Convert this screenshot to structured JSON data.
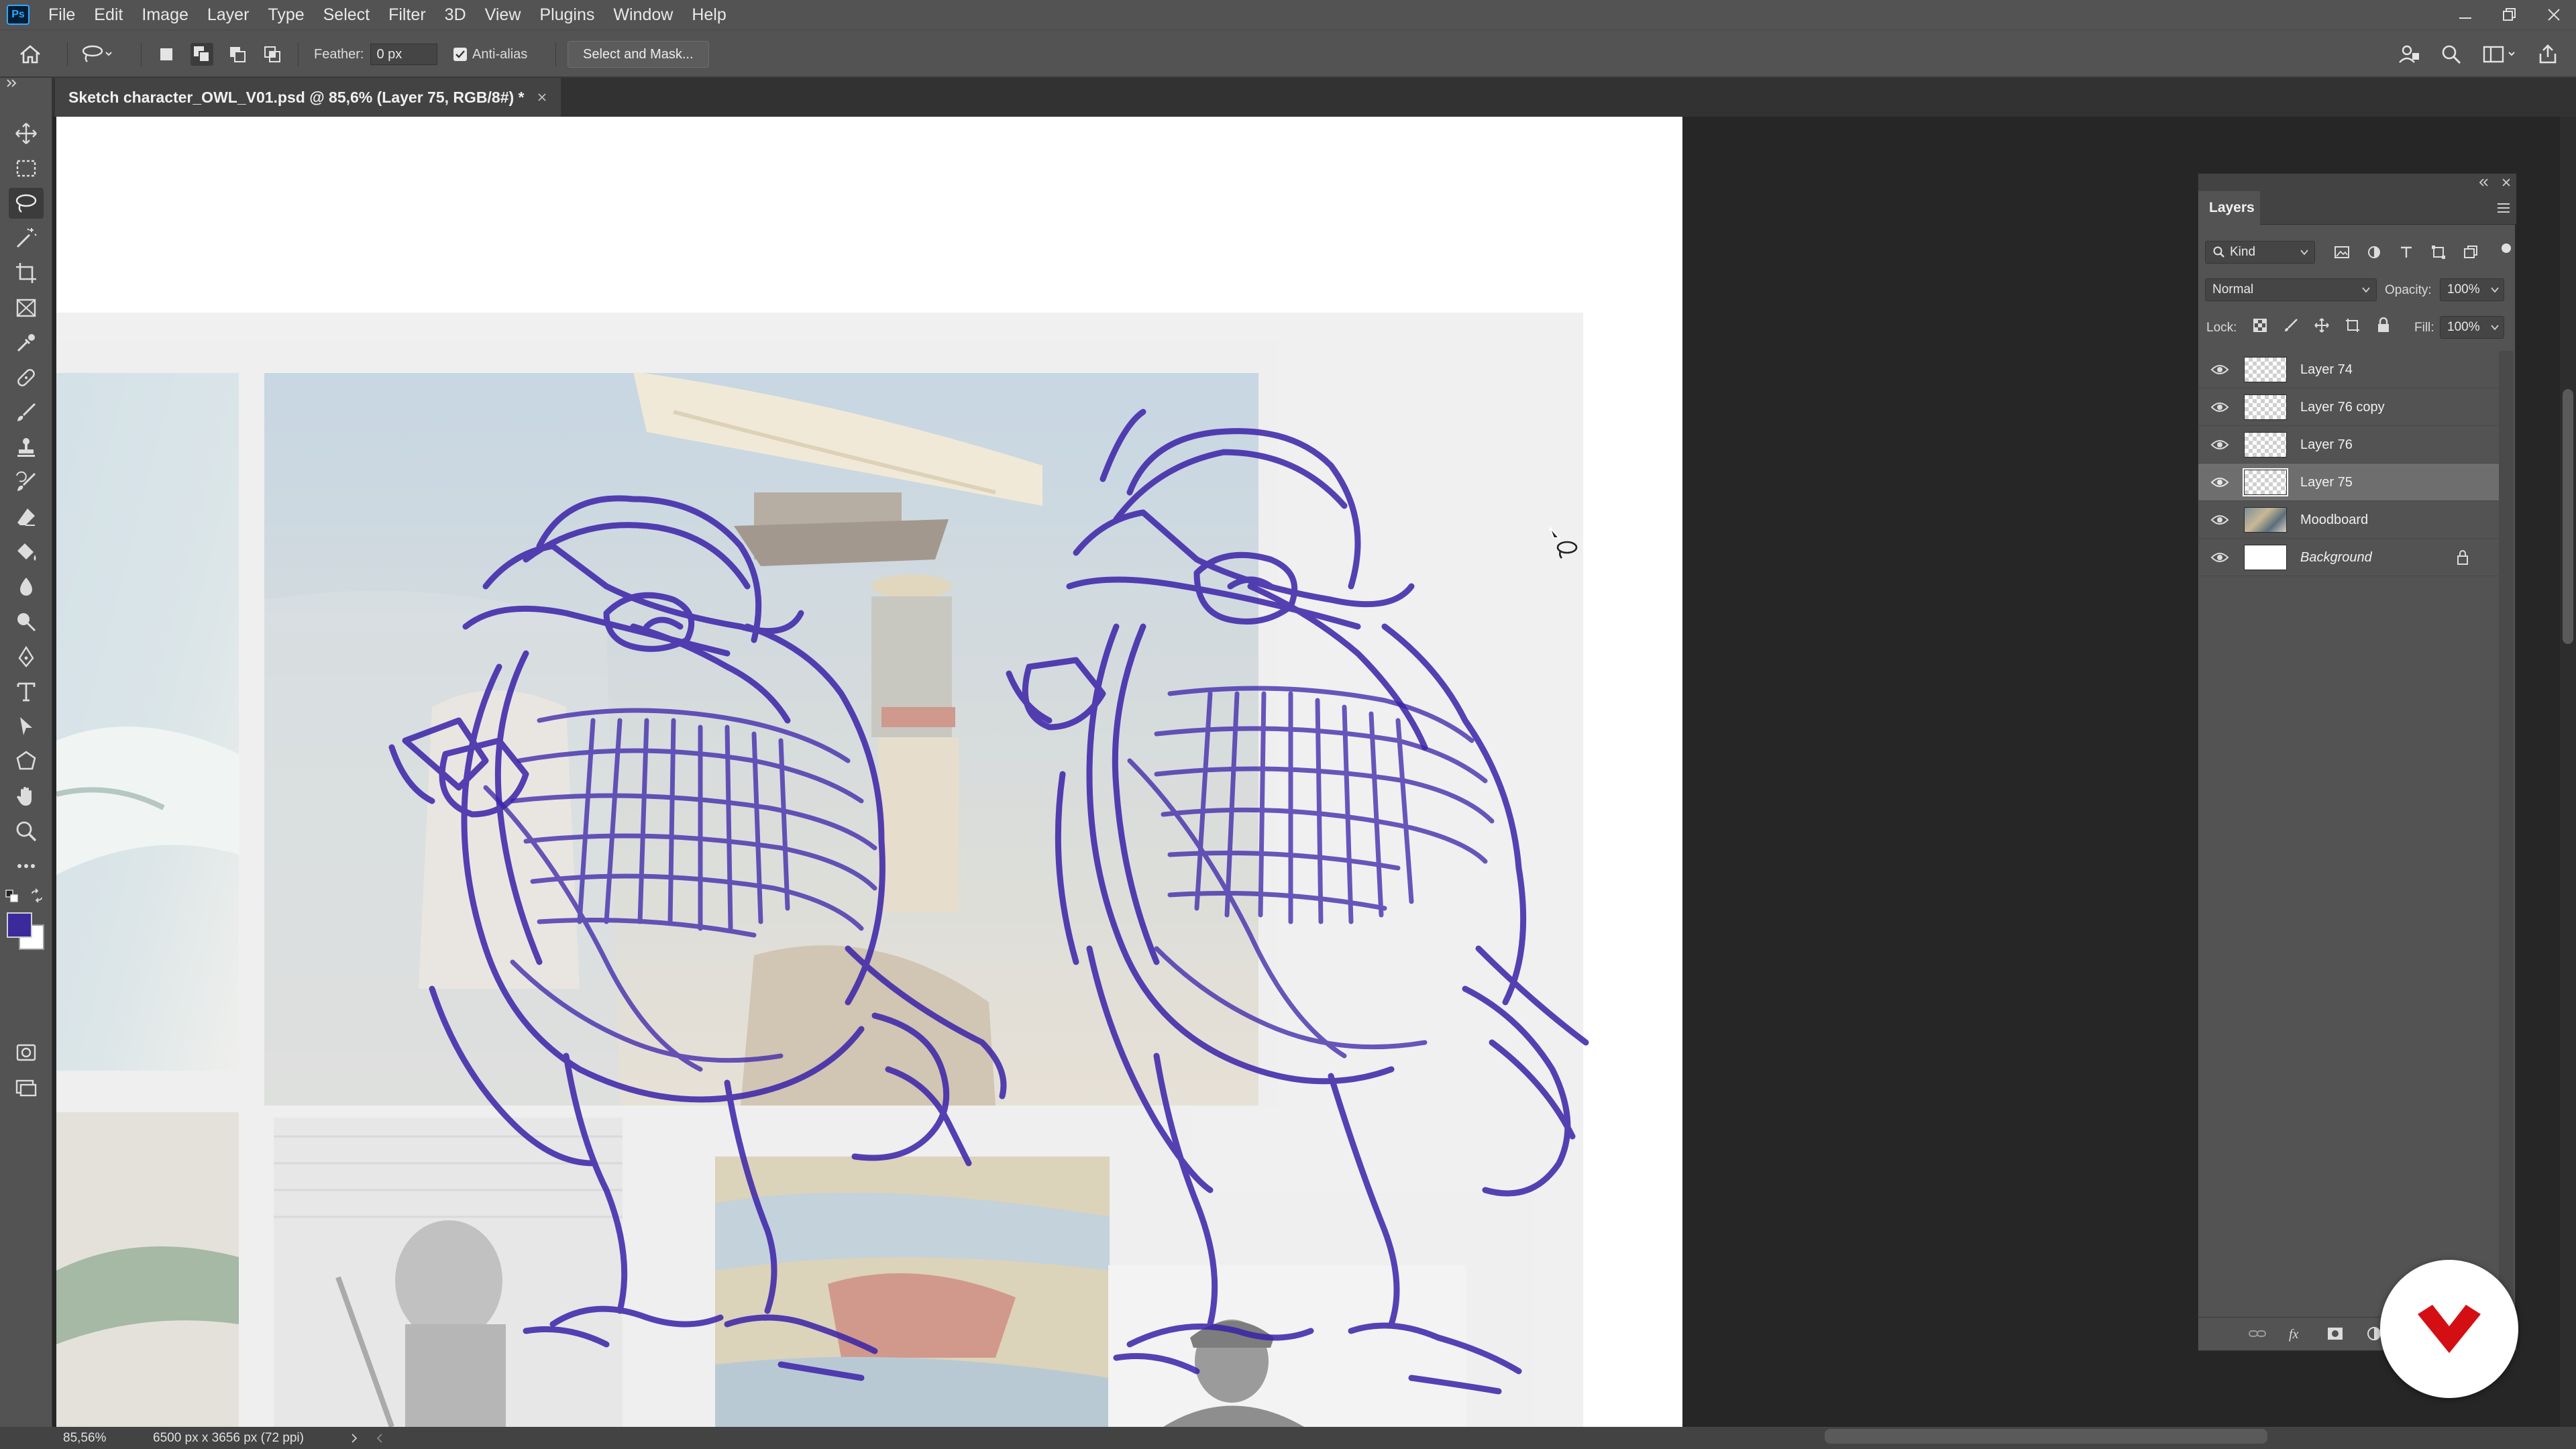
{
  "app": {
    "logo": "Ps"
  },
  "menu": [
    "File",
    "Edit",
    "Image",
    "Layer",
    "Type",
    "Select",
    "Filter",
    "3D",
    "View",
    "Plugins",
    "Window",
    "Help"
  ],
  "options": {
    "feather_label": "Feather:",
    "feather_value": "0 px",
    "antialias_label": "Anti-alias",
    "antialias_checked": true,
    "select_mask_label": "Select and Mask..."
  },
  "document": {
    "tab_title": "Sketch character_OWL_V01.psd @ 85,6% (Layer 75, RGB/8#) *"
  },
  "status": {
    "zoom": "85,56%",
    "doc_size": "6500 px x 3656 px (72 ppi)"
  },
  "colors": {
    "foreground": "#3a2a9c",
    "background": "#ffffff",
    "sketch_stroke": "#3a22a8",
    "badge_logo": "#d40f14"
  },
  "layers_panel": {
    "tab": "Layers",
    "filter_kind": "Kind",
    "blend_mode": "Normal",
    "opacity_label": "Opacity:",
    "opacity_value": "100%",
    "lock_label": "Lock:",
    "fill_label": "Fill:",
    "fill_value": "100%",
    "layers": [
      {
        "name": "Layer 74",
        "visible": true,
        "selected": false,
        "thumb": "transparent"
      },
      {
        "name": "Layer 76 copy",
        "visible": true,
        "selected": false,
        "thumb": "transparent"
      },
      {
        "name": "Layer 76",
        "visible": true,
        "selected": false,
        "thumb": "transparent"
      },
      {
        "name": "Layer 75",
        "visible": true,
        "selected": true,
        "thumb": "transparent"
      },
      {
        "name": "Moodboard",
        "visible": true,
        "selected": false,
        "thumb": "image"
      },
      {
        "name": "Background",
        "visible": true,
        "selected": false,
        "thumb": "white",
        "locked": true
      }
    ]
  },
  "icons": {
    "toolbar": [
      "move-icon",
      "marquee-icon",
      "lasso-icon",
      "magic-wand-icon",
      "crop-icon",
      "frame-icon",
      "eyedropper-icon",
      "healing-brush-icon",
      "brush-icon",
      "stamp-icon",
      "history-brush-icon",
      "eraser-icon",
      "paint-bucket-icon",
      "blur-icon",
      "dodge-icon",
      "pen-icon",
      "type-icon",
      "path-selection-icon",
      "shape-icon",
      "hand-icon",
      "zoom-icon",
      "more-tools-icon"
    ]
  }
}
